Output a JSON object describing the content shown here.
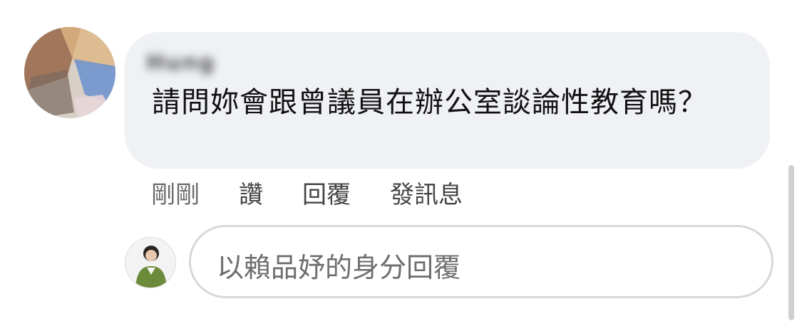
{
  "comment": {
    "author_name_obscured": "Hung",
    "text": "請問妳會跟曾議員在辦公室談論性教育嗎？"
  },
  "actions": {
    "time": "剛剛",
    "like": "讚",
    "reply": "回覆",
    "message": "發訊息"
  },
  "reply_box": {
    "placeholder": "以賴品妤的身分回覆"
  }
}
